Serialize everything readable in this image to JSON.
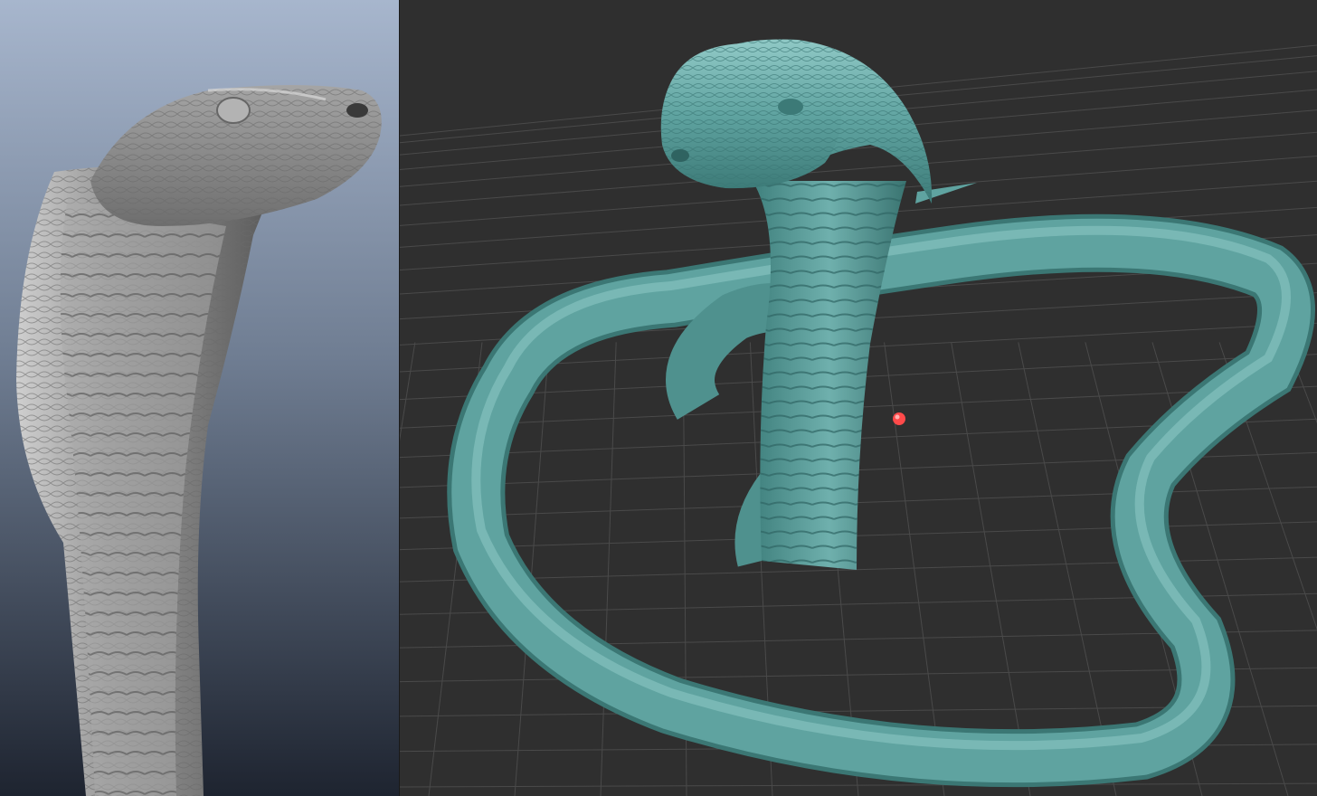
{
  "layout": "split-view",
  "left_viewport": {
    "background_top": "#a7b6cd",
    "background_bottom": "#1e2430",
    "model": "cobra-sculpt",
    "material_color": "#8e8e8e",
    "shading": "grey-clay"
  },
  "right_viewport": {
    "background": "#2f2f2f",
    "grid_color": "#4a4a4a",
    "model": "cobra-coiled",
    "material_color": "#5fa3a0",
    "marker_color": "#ff4a4a"
  }
}
